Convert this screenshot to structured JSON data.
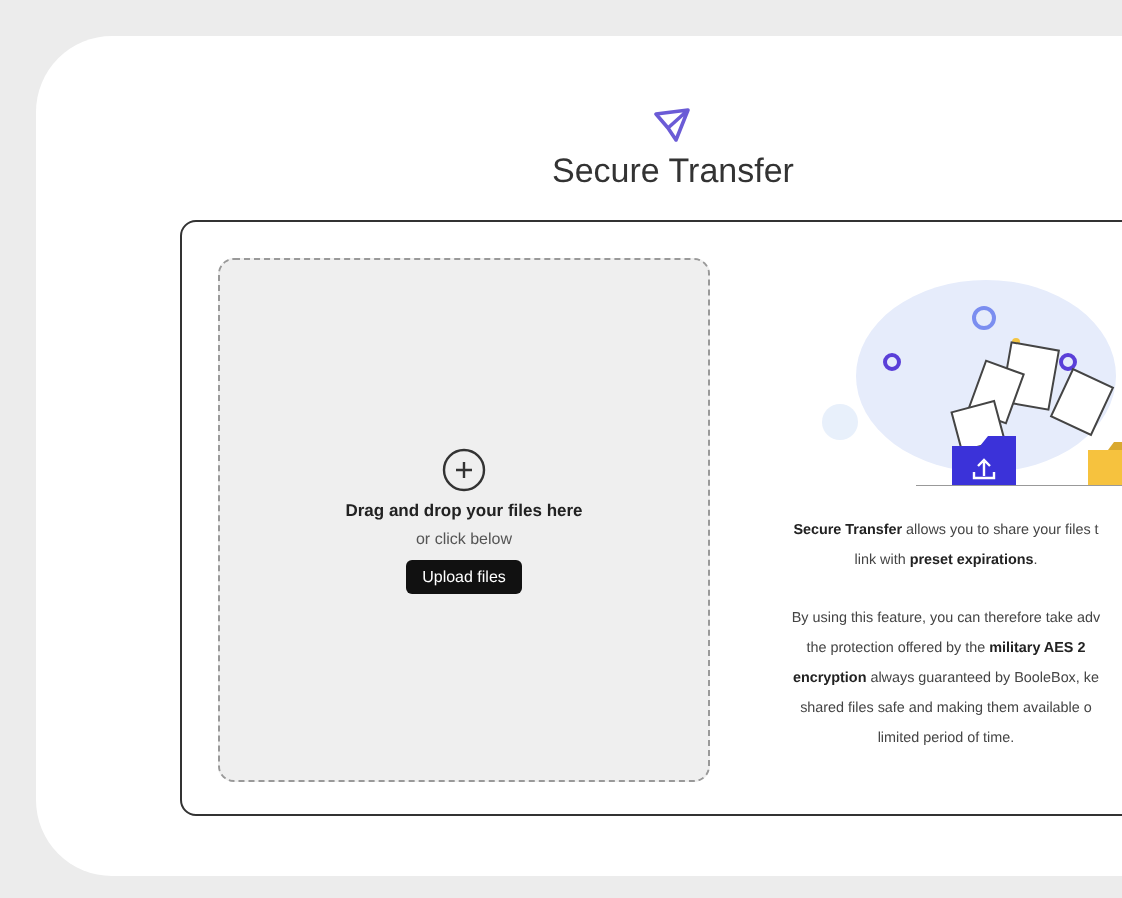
{
  "title": "Secure Transfer",
  "dropzone": {
    "heading": "Drag and drop your files here",
    "subtext": "or click below",
    "button": "Upload files"
  },
  "description": [
    [
      "**Secure Transfer** allows you to share your files t",
      "link with **preset expirations**."
    ],
    [
      "By using this feature, you can therefore take adv",
      "the protection offered by the **military AES 2**",
      "**encryption** always guaranteed by BooleBox, ke",
      "shared files safe and making them available o",
      "limited period of time."
    ]
  ]
}
